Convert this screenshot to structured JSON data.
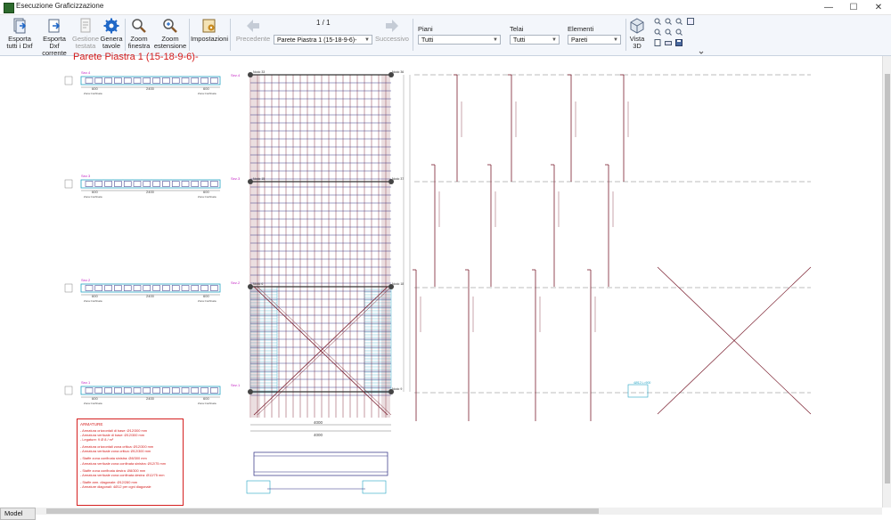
{
  "window": {
    "title": "Esecuzione Graficizzazione",
    "controls": [
      "—",
      "☐",
      "✕"
    ]
  },
  "toolbar": {
    "buttons": [
      {
        "id": "export-dxf-all",
        "label1": "Esporta",
        "label2": "tutti i Dxf",
        "icon": "export-all-icon"
      },
      {
        "id": "export-dxf-current",
        "label1": "Esporta Dxf",
        "label2": "corrente",
        "icon": "export-current-icon"
      },
      {
        "id": "header-management",
        "label1": "Gestione",
        "label2": "testata",
        "icon": "document-icon",
        "disabled": true
      },
      {
        "id": "generate-sheets",
        "label1": "Genera",
        "label2": "tavole",
        "icon": "gear-icon"
      },
      {
        "id": "zoom-window",
        "label1": "Zoom",
        "label2": "finestra",
        "icon": "magnifier-icon"
      },
      {
        "id": "zoom-extents",
        "label1": "Zoom",
        "label2": "estensione",
        "icon": "magnifier-extents-icon"
      },
      {
        "id": "settings",
        "label1": "Impostazioni",
        "label2": "",
        "icon": "settings-icon"
      }
    ],
    "nav": {
      "previous": "Precedente",
      "next": "Successivo",
      "page_counter": "1 / 1",
      "current_element": "Parete Piastra 1 (15-18-9-6)-"
    },
    "filters": {
      "piani_label": "Piani",
      "piani_value": "Tutti",
      "telai_label": "Telai",
      "telai_value": "Tutti",
      "elementi_label": "Elementi",
      "elementi_value": "Pareti"
    },
    "view3d": {
      "label1": "Vista",
      "label2": "3D"
    }
  },
  "drawing": {
    "title": "Parete Piastra 1 (15-18-9-6)-",
    "sections": [
      {
        "label": "Sez.4"
      },
      {
        "label": "Sez.3"
      },
      {
        "label": "Sez.2"
      },
      {
        "label": "Sez.1"
      }
    ],
    "section_dims": {
      "left": "600",
      "mid": "2400",
      "right": "600",
      "zone_left": "Zona Confinata",
      "zone_right": "Zona Confinata"
    },
    "node_labels": [
      "Nodo 33",
      "Nodo 36",
      "Nodo 37",
      "Nodo 15",
      "Nodo 18",
      "Nodo 6",
      "Nodo 9"
    ],
    "overall_dim": "4000",
    "notes": {
      "heading": "ARMATURE",
      "lines": [
        "- Armatura orizzontali di base: Ø12/300 mm",
        "- Armatura verticale di base: Ø12/300 mm",
        "- Legature: 9 Ø 8 / m²",
        "",
        "- Armatura orizzontali zona critica: Ø12/300 mm",
        "- Armatura verticale zona critica: Ø12/300 mm",
        "",
        "- Staffe zona confinata sinistra: Ø8/300 mm",
        "- Armatura verticale zona confinata sinistra: Ø12/75 mm",
        "",
        "- Staffe zona confinata destra: Ø8/300 mm",
        "- Armatura verticale zona confinata destra: Ø12/75 mm",
        "",
        "- Staffe arm. diagonale: Ø12/280 mm",
        "- Armature diagonali: 4Ø12 per ogni diagonale"
      ]
    },
    "diag_label": "4Ø12 L=900"
  },
  "status": {
    "tab": "Model"
  },
  "colors": {
    "ribbon_bg": "#f3f6fb",
    "title_red": "#d41b1b",
    "rebar": "#7a1e2e",
    "mesh": "#2b2b80",
    "confined": "#24a3c4",
    "magenta": "#c21fc2",
    "dash": "#7a7a7a"
  }
}
